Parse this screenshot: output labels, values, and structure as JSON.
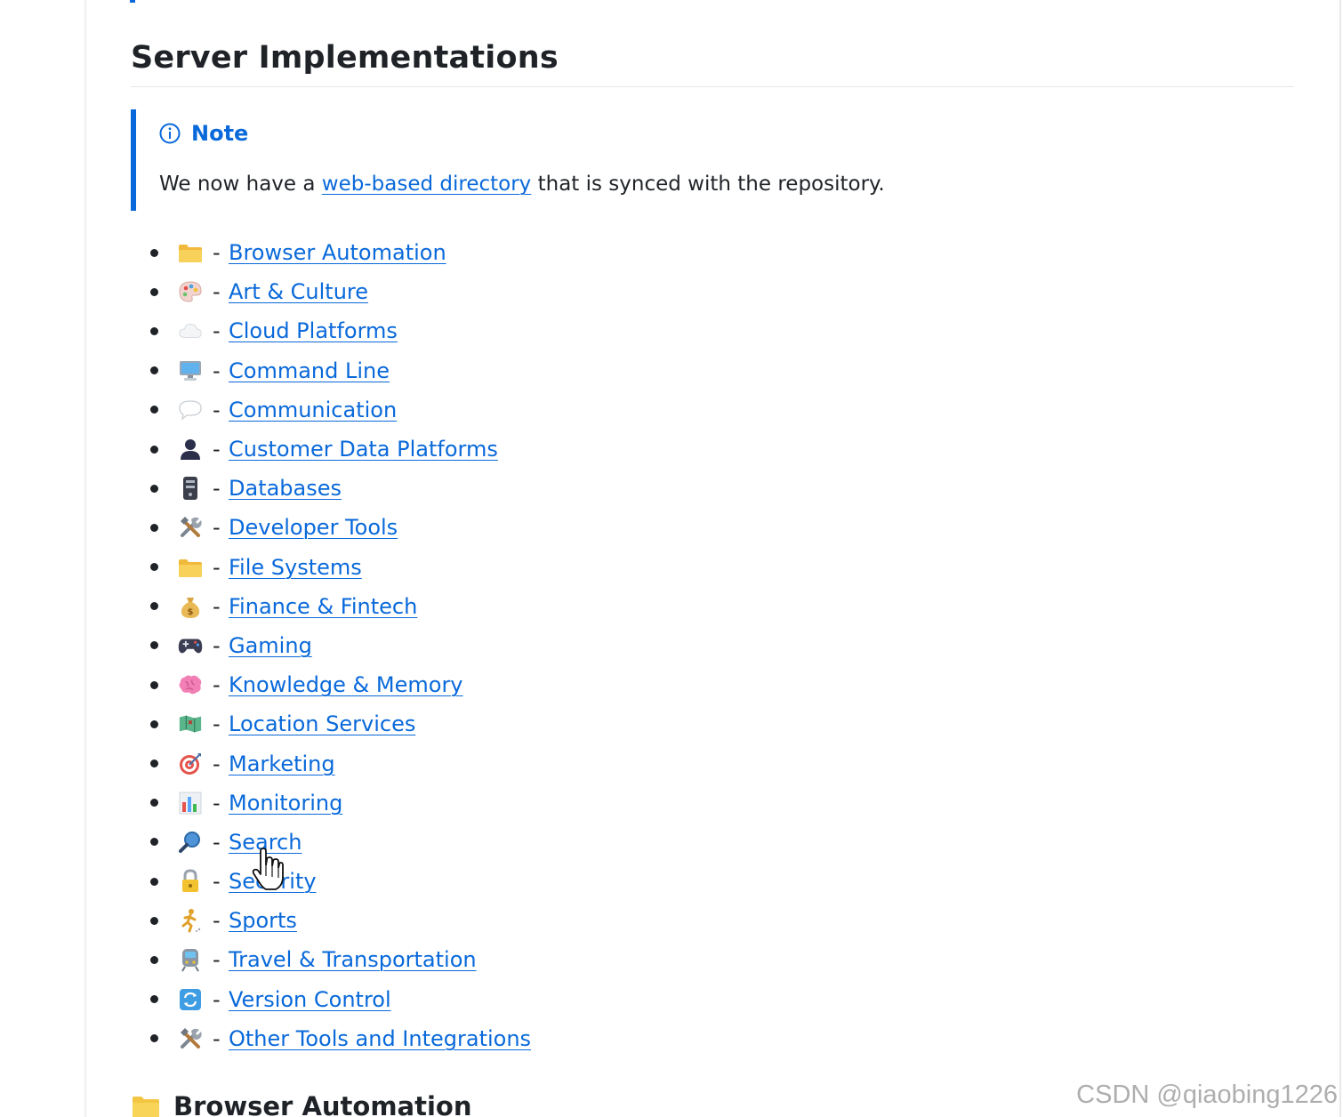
{
  "section": {
    "title": "Server Implementations"
  },
  "note": {
    "title": "Note",
    "text_before": "We now have a ",
    "link_text": "web-based directory",
    "text_after": " that is synced with the repository."
  },
  "categories": [
    {
      "icon": "folder-icon",
      "label": "Browser Automation"
    },
    {
      "icon": "palette-icon",
      "label": "Art & Culture"
    },
    {
      "icon": "cloud-icon",
      "label": "Cloud Platforms"
    },
    {
      "icon": "computer-icon",
      "label": "Command Line"
    },
    {
      "icon": "speech-bubble-icon",
      "label": "Communication"
    },
    {
      "icon": "person-icon",
      "label": "Customer Data Platforms"
    },
    {
      "icon": "database-icon",
      "label": "Databases"
    },
    {
      "icon": "tools-icon",
      "label": "Developer Tools"
    },
    {
      "icon": "folder-icon",
      "label": "File Systems"
    },
    {
      "icon": "money-bag-icon",
      "label": "Finance & Fintech"
    },
    {
      "icon": "game-controller-icon",
      "label": "Gaming"
    },
    {
      "icon": "brain-icon",
      "label": "Knowledge & Memory"
    },
    {
      "icon": "map-icon",
      "label": "Location Services"
    },
    {
      "icon": "target-icon",
      "label": "Marketing"
    },
    {
      "icon": "bar-chart-icon",
      "label": "Monitoring"
    },
    {
      "icon": "magnifier-icon",
      "label": "Search"
    },
    {
      "icon": "lock-icon",
      "label": "Security"
    },
    {
      "icon": "runner-icon",
      "label": "Sports"
    },
    {
      "icon": "train-icon",
      "label": "Travel & Transportation"
    },
    {
      "icon": "sync-icon",
      "label": "Version Control"
    },
    {
      "icon": "tools-icon",
      "label": "Other Tools and Integrations"
    }
  ],
  "next_heading": {
    "icon": "folder-icon",
    "title": "Browser Automation"
  },
  "dash": "-",
  "watermark": "CSDN @qiaobing1226"
}
